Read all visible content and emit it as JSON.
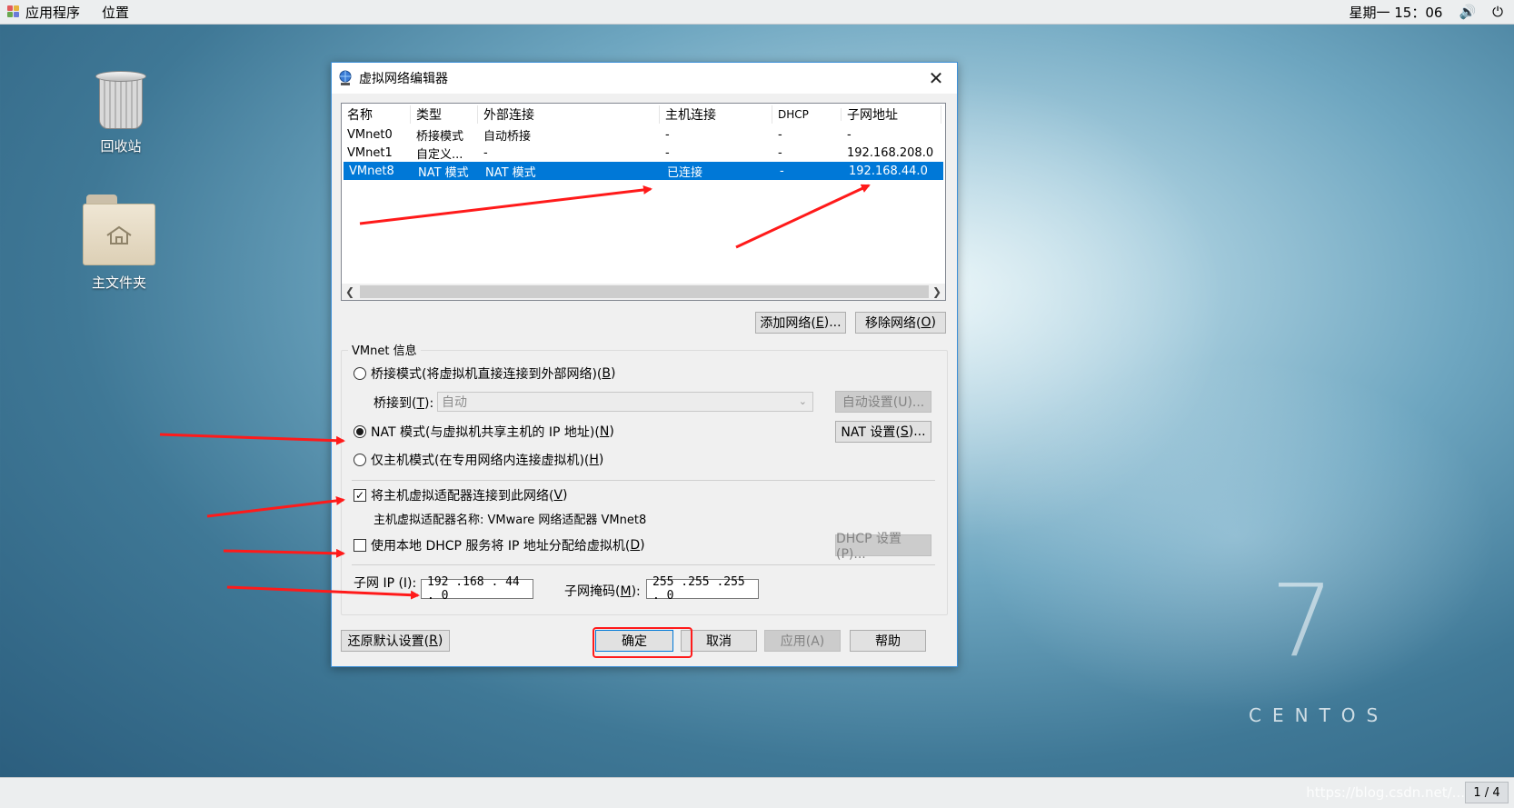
{
  "topbar": {
    "apps_label": "应用程序",
    "places_label": "位置",
    "clock": "星期一 15：06",
    "volume_icon": "speaker-icon",
    "power_icon": "power-icon"
  },
  "desktop": {
    "trash_label": "回收站",
    "home_label": "主文件夹",
    "centos_number": "7",
    "centos_text": "CENTOS"
  },
  "bottombar": {
    "pager": "1 / 4",
    "watermark": "https://blog.csdn.net/..."
  },
  "dialog": {
    "title": "虚拟网络编辑器",
    "table": {
      "headers": [
        "名称",
        "类型",
        "外部连接",
        "主机连接",
        "DHCP",
        "子网地址"
      ],
      "rows": [
        [
          "VMnet0",
          "桥接模式",
          "自动桥接",
          "-",
          "-",
          "-"
        ],
        [
          "VMnet1",
          "自定义...",
          "-",
          "-",
          "-",
          "192.168.208.0"
        ],
        [
          "VMnet8",
          "NAT 模式",
          "NAT 模式",
          "已连接",
          "-",
          "192.168.44.0"
        ]
      ]
    },
    "add_network": "添加网络(",
    "add_network_key": "E",
    "add_network_end": ")...",
    "remove_network": "移除网络(",
    "remove_network_key": "O",
    "remove_network_end": ")",
    "vmnet_info": "VMnet 信息",
    "bridge_mode": "桥接模式(将虚拟机直接连接到外部网络)(",
    "bridge_mode_key": "B",
    "bridge_to": "桥接到(",
    "bridge_to_key": "T",
    "bridge_to_end": "):",
    "bridge_select": "自动",
    "auto_settings": "自动设置(U)...",
    "nat_mode": "NAT 模式(与虚拟机共享主机的 IP 地址)(",
    "nat_mode_key": "N",
    "nat_settings": "NAT 设置(",
    "nat_settings_key": "S",
    "nat_settings_end": ")...",
    "host_only": "仅主机模式(在专用网络内连接虚拟机)(",
    "host_only_key": "H",
    "connect_adapter": "将主机虚拟适配器连接到此网络(",
    "connect_adapter_key": "V",
    "adapter_name": "主机虚拟适配器名称: VMware 网络适配器 VMnet8",
    "use_dhcp": "使用本地 DHCP 服务将 IP 地址分配给虚拟机(",
    "use_dhcp_key": "D",
    "dhcp_settings": "DHCP 设置(P)...",
    "subnet_ip_label": "子网 IP (I):",
    "subnet_ip": "192 .168 . 44  .  0",
    "subnet_mask_label": "子网掩码(",
    "subnet_mask_key": "M",
    "subnet_mask_end": "):",
    "subnet_mask": "255 .255 .255 .  0",
    "restore_defaults": "还原默认设置(",
    "restore_defaults_key": "R",
    "ok": "确定",
    "cancel": "取消",
    "apply": "应用(A)",
    "help": "帮助"
  },
  "colors": {
    "selection": "#0078d7",
    "annotation_red": "#ff1a1a",
    "dialog_border": "#3c8fd8"
  }
}
